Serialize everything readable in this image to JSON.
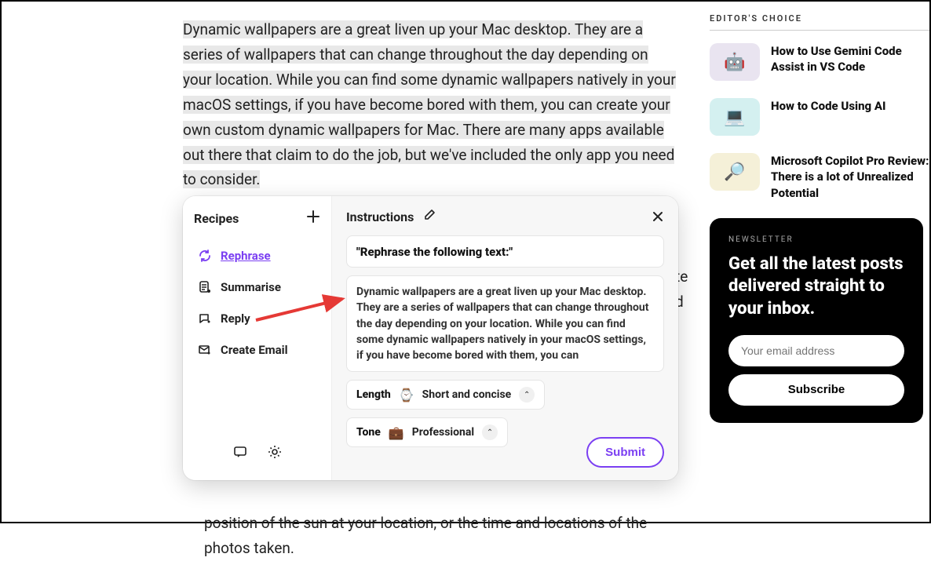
{
  "article": {
    "highlighted_text": "Dynamic wallpapers are a great liven up your Mac desktop. They are a series of wallpapers that can change throughout the day depending on your location. While you can find some dynamic wallpapers natively in your macOS settings, if you have become bored with them, you can create your own custom dynamic wallpapers for Mac. There are many apps available out there that claim to do the job, but we've included the only app you need to consider.",
    "body_behind_popup": "te d ",
    "body_bottom": "position of the sun at your location, or the time and locations of the photos taken."
  },
  "sidebar": {
    "editors_choice_label": "EDITOR'S CHOICE",
    "items": [
      {
        "title": "How to Use Gemini Code Assist in VS Code",
        "thumb_emoji": "🤖"
      },
      {
        "title": "How to Code Using AI",
        "thumb_emoji": "💻"
      },
      {
        "title": "Microsoft Copilot Pro Review: There is a lot of Unrealized Potential",
        "thumb_emoji": "🔎"
      }
    ]
  },
  "newsletter": {
    "label": "NEWSLETTER",
    "heading": "Get all the latest posts delivered straight to your inbox.",
    "placeholder": "Your email address",
    "button": "Subscribe"
  },
  "popup": {
    "recipes_title": "Recipes",
    "recipes": [
      {
        "label": "Rephrase",
        "active": true
      },
      {
        "label": "Summarise",
        "active": false
      },
      {
        "label": "Reply",
        "active": false
      },
      {
        "label": "Create Email",
        "active": false
      }
    ],
    "instructions_title": "Instructions",
    "prompt_label": "\"Rephrase the following text:\"",
    "context_text": "Dynamic wallpapers are a great liven up your Mac desktop. They are a series of wallpapers that can change throughout the day depending on your location. While you can find some dynamic wallpapers natively in your macOS settings, if you have become bored with them, you can",
    "options": {
      "length": {
        "key": "Length",
        "emoji": "⌚",
        "value": "Short and concise"
      },
      "tone": {
        "key": "Tone",
        "emoji": "💼",
        "value": "Professional"
      }
    },
    "submit": "Submit"
  }
}
